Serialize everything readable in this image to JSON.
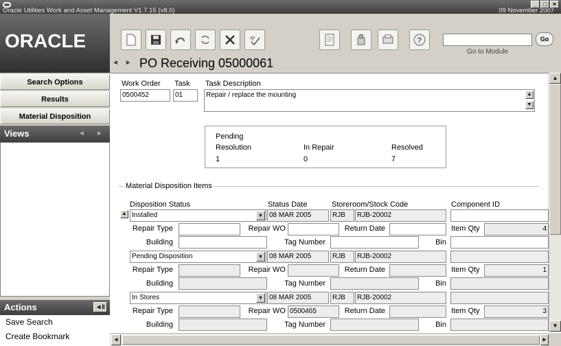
{
  "window": {
    "title": "Oracle Utilities Work and Asset Management V1.7.15 (v8.0)",
    "date": "09 November 2007",
    "minimize": "_",
    "maximize": "□",
    "close": "×"
  },
  "brand": {
    "logo_text": "ORACLE"
  },
  "toolbar": {
    "icons": [
      "new-icon",
      "save-icon",
      "undo-icon",
      "refresh-icon",
      "delete-icon",
      "spell-check-icon",
      "report-icon",
      "routing-icon",
      "print-icon",
      "help-icon"
    ],
    "goto_label": "Go to Module",
    "go_button": "Go",
    "module_value": ""
  },
  "page": {
    "title": "PO Receiving 05000061",
    "nav_back": "◄",
    "nav_fwd": "►"
  },
  "sidebar": {
    "items": [
      {
        "label": "Search Options"
      },
      {
        "label": "Results"
      },
      {
        "label": "Material Disposition"
      }
    ],
    "views_label": "Views",
    "actions_label": "Actions",
    "actions": [
      {
        "label": "Save Search"
      },
      {
        "label": "Create Bookmark"
      }
    ]
  },
  "form": {
    "work_order_label": "Work Order",
    "work_order": "0500452",
    "task_label": "Task",
    "task": "01",
    "task_desc_label": "Task Description",
    "task_desc": "Repair / replace the mounting"
  },
  "pending": {
    "title": "Pending",
    "columns": [
      "Resolution",
      "In Repair",
      "Resolved"
    ],
    "values": [
      "1",
      "0",
      "7"
    ]
  },
  "disposition": {
    "section_label": "Material Disposition Items",
    "headers": {
      "status": "Disposition Status",
      "date": "Status Date",
      "store": "Storeroom/Stock Code",
      "component": "Component ID"
    },
    "labels": {
      "repair_type": "Repair Type",
      "repair_wo": "Repair WO",
      "return_date": "Return Date",
      "item_qty": "Item Qty",
      "building": "Building",
      "tag_number": "Tag Number",
      "bin": "Bin"
    },
    "rows": [
      {
        "status": "Installed",
        "date": "08 MAR 2005",
        "store": "RJB",
        "stock": "RJB-20002",
        "component": "",
        "repair_type": "",
        "repair_wo": "",
        "return_date": "",
        "qty": "4",
        "building": "",
        "tag": "",
        "bin": ""
      },
      {
        "status": "Pending Disposition",
        "date": "08 MAR 2005",
        "store": "RJB",
        "stock": "RJB-20002",
        "component": "",
        "repair_type": "",
        "repair_wo": "",
        "return_date": "",
        "qty": "1",
        "building": "",
        "tag": "",
        "bin": ""
      },
      {
        "status": "In Stores",
        "date": "08 MAR 2005",
        "store": "RJB",
        "stock": "RJB-20002",
        "component": "",
        "repair_type": "",
        "repair_wo": "0500465",
        "return_date": "",
        "qty": "3",
        "building": "",
        "tag": "",
        "bin": ""
      }
    ]
  }
}
